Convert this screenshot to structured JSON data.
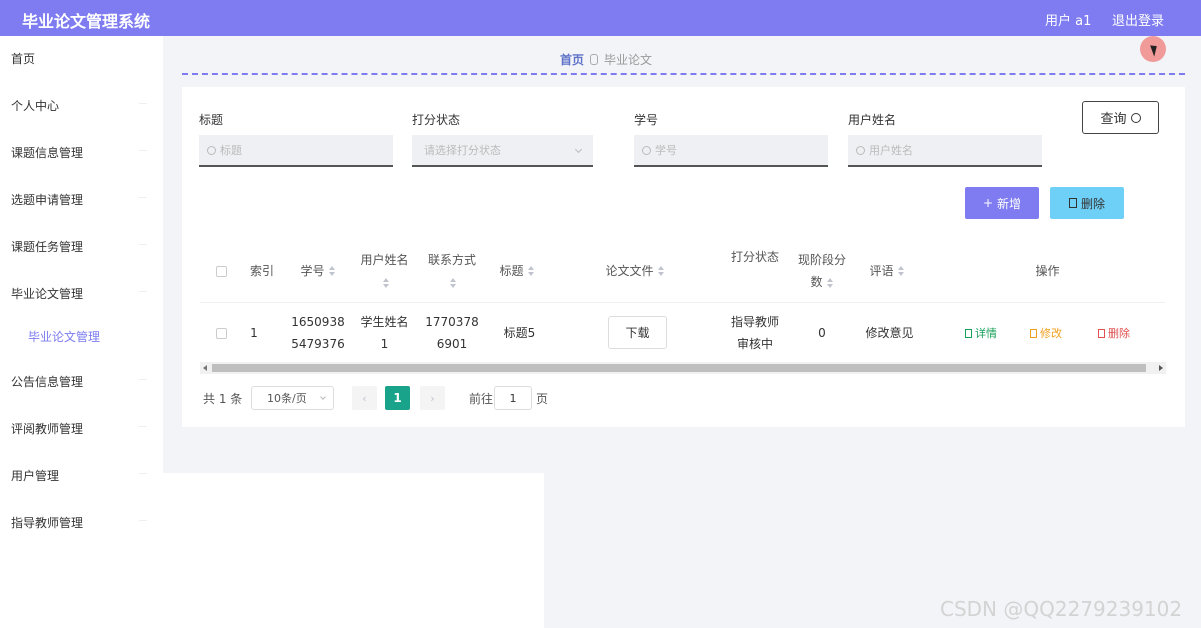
{
  "header": {
    "title": "毕业论文管理系统",
    "user": "用户 a1",
    "logout": "退出登录"
  },
  "sidebar": {
    "items": [
      "首页",
      "个人中心",
      "课题信息管理",
      "选题申请管理",
      "课题任务管理",
      "毕业论文管理",
      "毕业论文管理",
      "公告信息管理",
      "评阅教师管理",
      "用户管理",
      "指导教师管理"
    ]
  },
  "breadcrumb": {
    "home": "首页",
    "current": "毕业论文"
  },
  "filters": {
    "title_label": "标题",
    "title_placeholder": "标题",
    "status_label": "打分状态",
    "status_placeholder": "请选择打分状态",
    "id_label": "学号",
    "id_placeholder": "学号",
    "name_label": "用户姓名",
    "name_placeholder": "用户姓名",
    "query_button": "查询"
  },
  "actions": {
    "add": "新增",
    "delete": "删除"
  },
  "table": {
    "headers": {
      "index": "索引",
      "student_id": "学号",
      "user_name": "用户姓名",
      "contact": "联系方式",
      "title": "标题",
      "file": "论文文件",
      "status": "打分状态",
      "score": "现阶段分数",
      "comment": "评语",
      "ops": "操作"
    },
    "row": {
      "index": "1",
      "student_id": "16509385479376",
      "user_name": "学生姓名1",
      "contact": "17703786901",
      "title": "标题5",
      "file_button": "下载",
      "status": "指导教师审核中",
      "score": "0",
      "comment": "修改意见",
      "op_detail": "详情",
      "op_edit": "修改",
      "op_delete": "删除"
    }
  },
  "pagination": {
    "total": "共 1 条",
    "page_size": "10条/页",
    "prev": "‹",
    "current": "1",
    "next": "›",
    "goto": "前往",
    "goto_value": "1",
    "page_word": "页"
  },
  "watermark": "CSDN @QQ2279239102",
  "colors": {
    "primary": "#7e7cf0",
    "danger_light": "#6fd0f7",
    "success": "#1aa38b",
    "detail": "#18a058",
    "edit": "#f0a020",
    "delete": "#e05050"
  }
}
